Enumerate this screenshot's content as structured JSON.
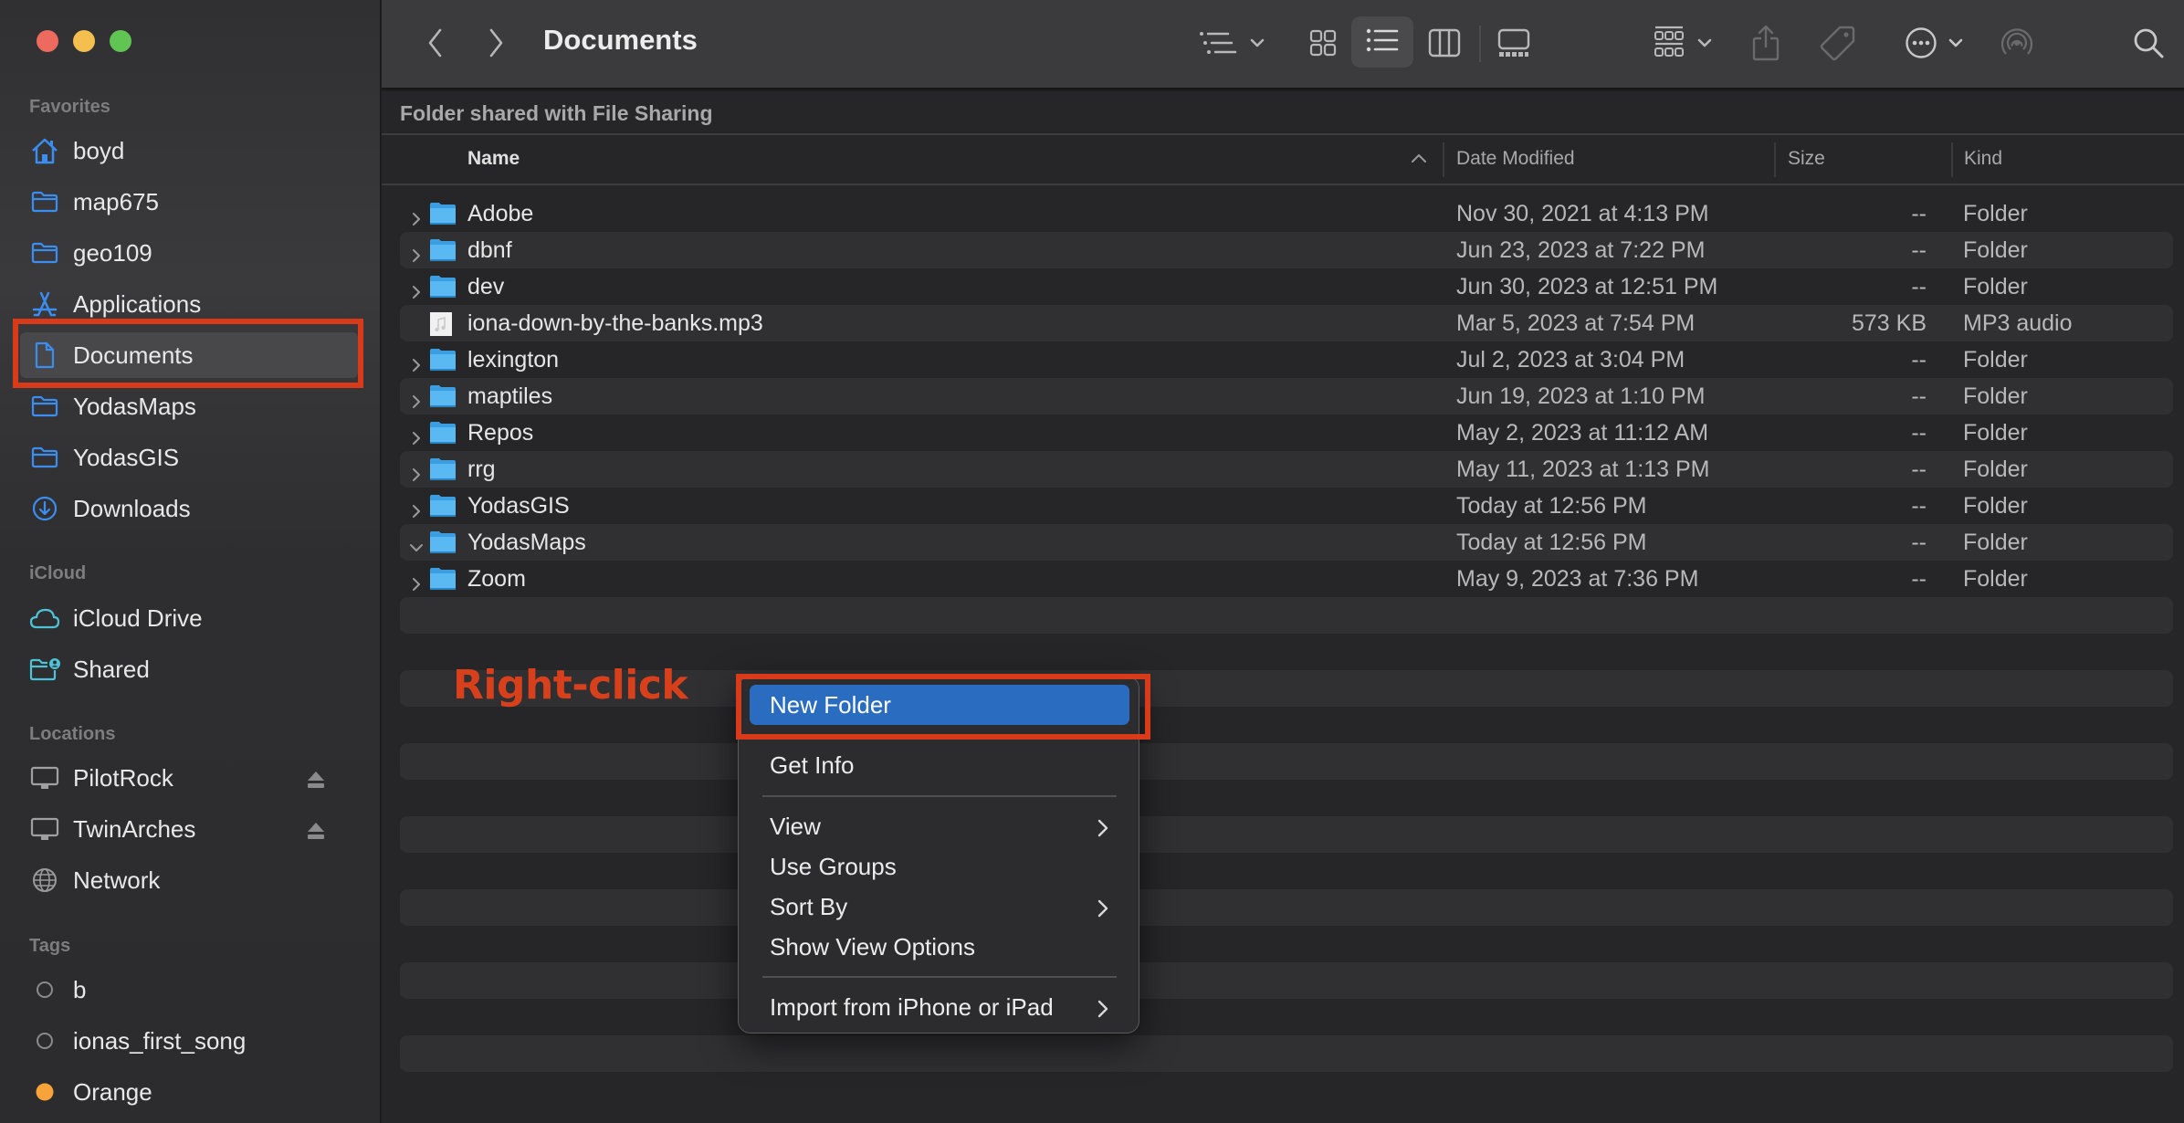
{
  "window": {
    "title": "Documents",
    "traffic_lights": [
      "close",
      "minimize",
      "zoom"
    ]
  },
  "sidebar": {
    "sections": [
      {
        "label": "Favorites",
        "items": [
          {
            "label": "boyd",
            "icon": "home-icon"
          },
          {
            "label": "map675",
            "icon": "folder-icon"
          },
          {
            "label": "geo109",
            "icon": "folder-icon"
          },
          {
            "label": "Applications",
            "icon": "applications-icon"
          },
          {
            "label": "Documents",
            "icon": "document-icon",
            "selected": true
          },
          {
            "label": "YodasMaps",
            "icon": "folder-icon"
          },
          {
            "label": "YodasGIS",
            "icon": "folder-icon"
          },
          {
            "label": "Downloads",
            "icon": "download-icon"
          }
        ]
      },
      {
        "label": "iCloud",
        "items": [
          {
            "label": "iCloud Drive",
            "icon": "cloud-icon"
          },
          {
            "label": "Shared",
            "icon": "shared-folder-icon"
          }
        ]
      },
      {
        "label": "Locations",
        "items": [
          {
            "label": "PilotRock",
            "icon": "computer-icon",
            "ejectable": true
          },
          {
            "label": "TwinArches",
            "icon": "computer-icon",
            "ejectable": true
          },
          {
            "label": "Network",
            "icon": "globe-icon"
          }
        ]
      },
      {
        "label": "Tags",
        "items": [
          {
            "label": "b",
            "icon": "tag-circle-icon",
            "color": "none"
          },
          {
            "label": "ionas_first_song",
            "icon": "tag-circle-icon",
            "color": "none"
          },
          {
            "label": "Orange",
            "icon": "tag-circle-icon",
            "color": "#f7a33a"
          }
        ]
      }
    ]
  },
  "toolbar": {
    "back": "back-icon",
    "forward": "forward-icon",
    "title": "Documents",
    "view_modes": [
      "icon",
      "list",
      "column",
      "gallery"
    ],
    "selected_view": "list"
  },
  "content": {
    "banner": "Folder shared with File Sharing",
    "columns": {
      "name": "Name",
      "date": "Date Modified",
      "size": "Size",
      "kind": "Kind"
    },
    "sort_column": "Name",
    "sort_direction": "ascending",
    "files": [
      {
        "name": "Adobe",
        "date": "Nov 30, 2021 at 4:13 PM",
        "size": "--",
        "kind": "Folder",
        "type": "folder",
        "expanded": false
      },
      {
        "name": "dbnf",
        "date": "Jun 23, 2023 at 7:22 PM",
        "size": "--",
        "kind": "Folder",
        "type": "folder",
        "expanded": false
      },
      {
        "name": "dev",
        "date": "Jun 30, 2023 at 12:51 PM",
        "size": "--",
        "kind": "Folder",
        "type": "folder",
        "expanded": false
      },
      {
        "name": "iona-down-by-the-banks.mp3",
        "date": "Mar 5, 2023 at 7:54 PM",
        "size": "573 KB",
        "kind": "MP3 audio",
        "type": "audio"
      },
      {
        "name": "lexington",
        "date": "Jul 2, 2023 at 3:04 PM",
        "size": "--",
        "kind": "Folder",
        "type": "folder",
        "expanded": false
      },
      {
        "name": "maptiles",
        "date": "Jun 19, 2023 at 1:10 PM",
        "size": "--",
        "kind": "Folder",
        "type": "folder",
        "expanded": false
      },
      {
        "name": "Repos",
        "date": "May 2, 2023 at 11:12 AM",
        "size": "--",
        "kind": "Folder",
        "type": "folder",
        "expanded": false
      },
      {
        "name": "rrg",
        "date": "May 11, 2023 at 1:13 PM",
        "size": "--",
        "kind": "Folder",
        "type": "folder",
        "expanded": false
      },
      {
        "name": "YodasGIS",
        "date": "Today at 12:56 PM",
        "size": "--",
        "kind": "Folder",
        "type": "folder",
        "expanded": false
      },
      {
        "name": "YodasMaps",
        "date": "Today at 12:56 PM",
        "size": "--",
        "kind": "Folder",
        "type": "folder",
        "expanded": true
      },
      {
        "name": "Zoom",
        "date": "May 9, 2023 at 7:36 PM",
        "size": "--",
        "kind": "Folder",
        "type": "folder",
        "expanded": false
      }
    ]
  },
  "annotation": {
    "text": "Right-click",
    "color": "#d8401c"
  },
  "context_menu": {
    "items": [
      {
        "label": "New Folder",
        "selected": true,
        "submenu": false
      },
      {
        "separator": true
      },
      {
        "label": "Get Info",
        "submenu": false
      },
      {
        "separator": true
      },
      {
        "label": "View",
        "submenu": true
      },
      {
        "label": "Use Groups",
        "submenu": false
      },
      {
        "label": "Sort By",
        "submenu": true
      },
      {
        "label": "Show View Options",
        "submenu": false
      },
      {
        "separator": true
      },
      {
        "label": "Import from iPhone or iPad",
        "submenu": true
      }
    ],
    "highlight_color": "#2a6cc0"
  },
  "colors": {
    "accent": "#2a6cc0",
    "annotation_box": "#d93a1a",
    "folder": "#5ab4f0",
    "sidebar_icon": "#3b8ef0"
  }
}
